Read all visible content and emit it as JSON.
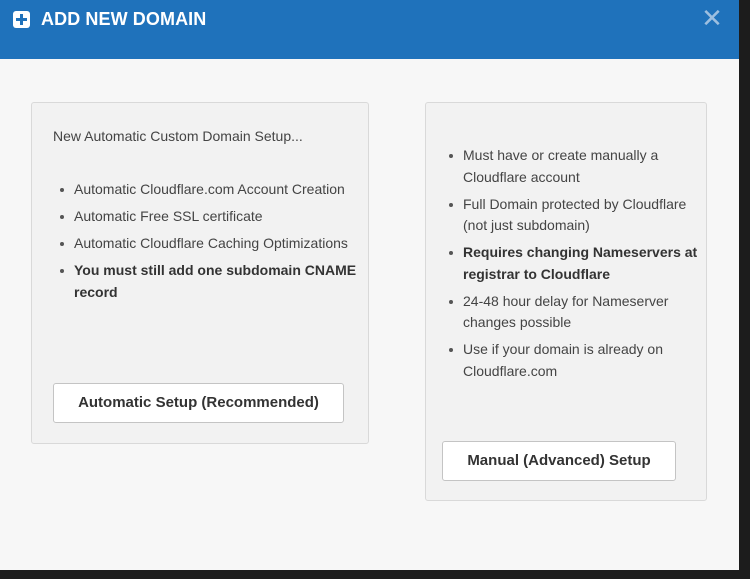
{
  "header": {
    "title": "ADD NEW DOMAIN",
    "close_symbol": "✕",
    "icons": {
      "add": "plus-square-icon",
      "close": "close-icon"
    },
    "colors": {
      "bar": "#1f72bb",
      "text": "#ffffff"
    }
  },
  "left_panel": {
    "intro": "New Automatic Custom Domain Setup...",
    "items": [
      {
        "text": "Automatic Cloudflare.com Account Creation",
        "bold": false
      },
      {
        "text": "Automatic Free SSL certificate",
        "bold": false
      },
      {
        "text": "Automatic Cloudflare Caching Optimizations",
        "bold": false
      },
      {
        "text": "You must still add one subdomain CNAME record",
        "bold": true
      }
    ],
    "button_label": "Automatic Setup (Recommended)"
  },
  "right_panel": {
    "items": [
      {
        "text": "Must have or create manually a Cloudflare account",
        "bold": false
      },
      {
        "text": "Full Domain protected by Cloudflare (not just subdomain)",
        "bold": false
      },
      {
        "text": "Requires changing Nameservers at registrar to Cloudflare",
        "bold": true
      },
      {
        "text": "24-48 hour delay for Nameserver changes possible",
        "bold": false
      },
      {
        "text": "Use if your domain is already on Cloudflare.com",
        "bold": false
      }
    ],
    "button_label": "Manual (Advanced) Setup"
  }
}
